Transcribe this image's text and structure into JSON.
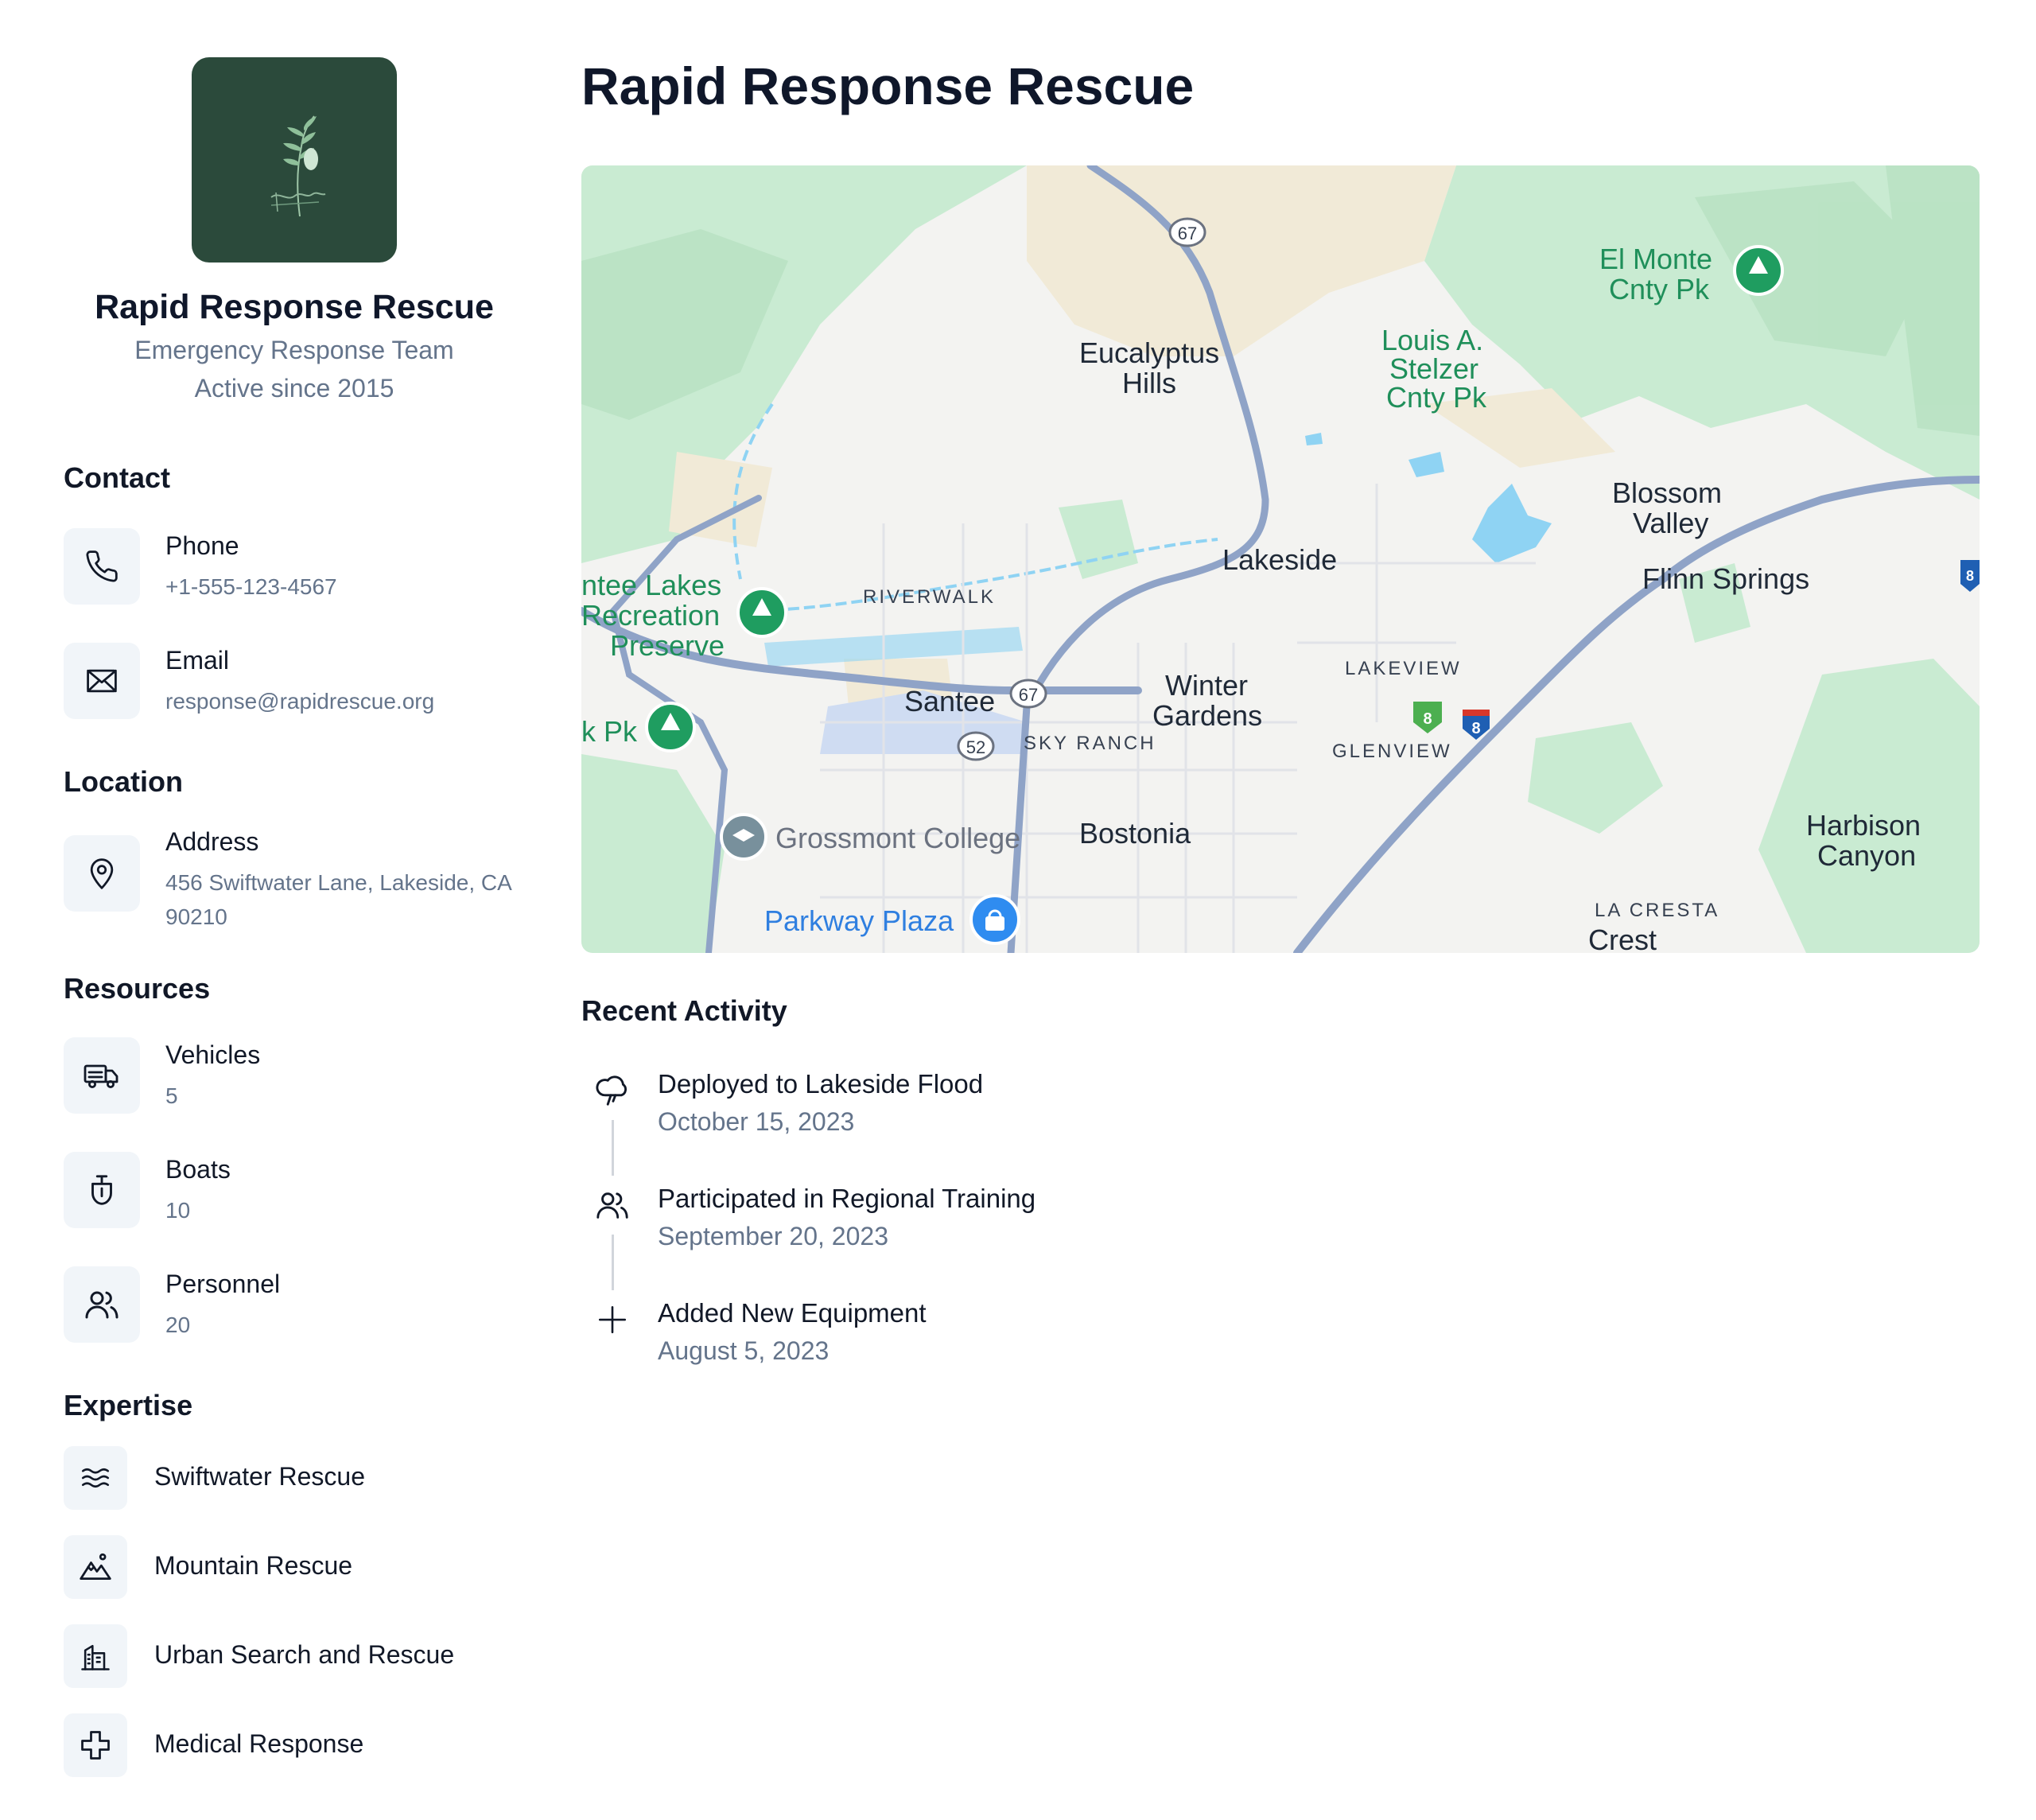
{
  "profile": {
    "name": "Rapid Response Rescue",
    "type": "Emergency Response Team",
    "since": "Active since 2015",
    "logo_icon": "fern-leaf-logo"
  },
  "contact": {
    "title": "Contact",
    "phone": {
      "label": "Phone",
      "value": "+1-555-123-4567",
      "icon": "phone-icon"
    },
    "email": {
      "label": "Email",
      "value": "response@rapidrescue.org",
      "icon": "mail-icon"
    }
  },
  "location": {
    "title": "Location",
    "address": {
      "label": "Address",
      "value": "456 Swiftwater Lane, Lakeside, CA 90210",
      "icon": "map-pin-icon"
    }
  },
  "resources": {
    "title": "Resources",
    "items": [
      {
        "label": "Vehicles",
        "value": "5",
        "icon": "truck-icon"
      },
      {
        "label": "Boats",
        "value": "10",
        "icon": "boat-icon"
      },
      {
        "label": "Personnel",
        "value": "20",
        "icon": "users-icon"
      }
    ]
  },
  "expertise": {
    "title": "Expertise",
    "items": [
      {
        "label": "Swiftwater Rescue",
        "icon": "waves-icon"
      },
      {
        "label": "Mountain Rescue",
        "icon": "mountain-icon"
      },
      {
        "label": "Urban Search and Rescue",
        "icon": "building-icon"
      },
      {
        "label": "Medical Response",
        "icon": "medical-cross-icon"
      }
    ]
  },
  "main": {
    "title": "Rapid Response Rescue"
  },
  "map": {
    "labels": {
      "el_monte": "El Monte",
      "el_monte2": "Cnty Pk",
      "eucalyptus": "Eucalyptus",
      "eucalyptus2": "Hills",
      "louis1": "Louis A.",
      "louis2": "Stelzer",
      "louis3": "Cnty Pk",
      "blossom1": "Blossom",
      "blossom2": "Valley",
      "lakeside": "Lakeside",
      "flinn": "Flinn Springs",
      "mission1": "ntee Lakes",
      "mission2": "Recreation",
      "mission3": "Preserve",
      "riverwalk": "RIVERWALK",
      "santee": "Santee",
      "winter1": "Winter",
      "winter2": "Gardens",
      "lakeview": "LAKEVIEW",
      "glenview": "GLENVIEW",
      "skyranch": "SKY RANCH",
      "kpk": "k Pk",
      "grossmont": "Grossmont College",
      "bostonia": "Bostonia",
      "harbison1": "Harbison",
      "harbison2": "Canyon",
      "parkway": "Parkway Plaza",
      "lacresta": "LA CRESTA",
      "crest": "Crest",
      "r67a": "67",
      "r67b": "67",
      "r52": "52",
      "r8a": "8",
      "r8b": "8",
      "r8c": "8"
    }
  },
  "activity": {
    "title": "Recent Activity",
    "items": [
      {
        "label": "Deployed to Lakeside Flood",
        "date": "October 15, 2023",
        "icon": "cloud-rain-icon"
      },
      {
        "label": "Participated in Regional Training",
        "date": "September 20, 2023",
        "icon": "users-icon"
      },
      {
        "label": "Added New Equipment",
        "date": "August 5, 2023",
        "icon": "plus-icon"
      }
    ]
  },
  "colors": {
    "accent_dark_green": "#2b4a3b",
    "muted_text": "#64748b",
    "tile_bg": "#f1f5f9",
    "map_park": "#c8ecd2",
    "map_road": "#8fa3c7",
    "map_water": "#8fd0f0"
  }
}
